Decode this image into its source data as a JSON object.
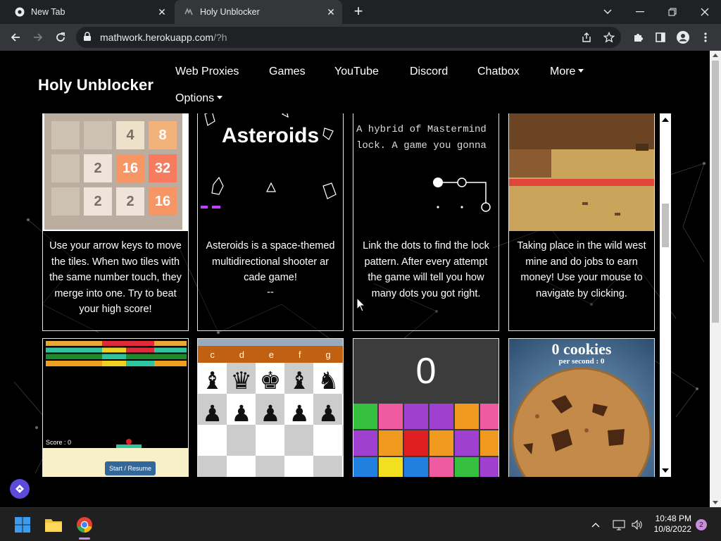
{
  "browser": {
    "tabs": [
      {
        "title": "New Tab",
        "active": false
      },
      {
        "title": "Holy Unblocker",
        "active": true
      }
    ],
    "url_host": "mathwork.herokuapp.com",
    "url_path": "/?h"
  },
  "site": {
    "brand": "Holy Unblocker",
    "nav": {
      "web_proxies": "Web Proxies",
      "games": "Games",
      "youtube": "YouTube",
      "discord": "Discord",
      "chatbox": "Chatbox",
      "more": "More",
      "options": "Options"
    }
  },
  "games": {
    "g2048": {
      "description": "Use your arrow keys to move the tiles. When two tiles with the same number touch, they merge into one. Try to beat your high score!",
      "tiles": [
        "4",
        "8",
        "2",
        "16",
        "32",
        "2",
        "2",
        "16"
      ]
    },
    "asteroids": {
      "title": "Asteroids",
      "description": "Asteroids is a space-themed multidirectional shooter ar cade game!",
      "footer": "--"
    },
    "lock": {
      "line1": "A hybrid of Mastermind",
      "line2": "lock. A game you gonna",
      "description": "Link the dots to find the lock pattern. After every attempt the game will tell you how many dots you got right."
    },
    "wildwest": {
      "description": "Taking place in the wild west mine and do jobs to earn money! Use your mouse to navigate by clicking."
    },
    "breakout": {
      "score": "Score : 0",
      "button": "Start / Resume"
    },
    "chess": {
      "files": [
        "c",
        "d",
        "e",
        "f",
        "g"
      ]
    },
    "gems": {
      "score": "0"
    },
    "cookie": {
      "title": "0 cookies",
      "subtitle": "per second : 0"
    }
  },
  "taskbar": {
    "time": "10:48 PM",
    "date": "10/8/2022",
    "notifications": "2"
  }
}
